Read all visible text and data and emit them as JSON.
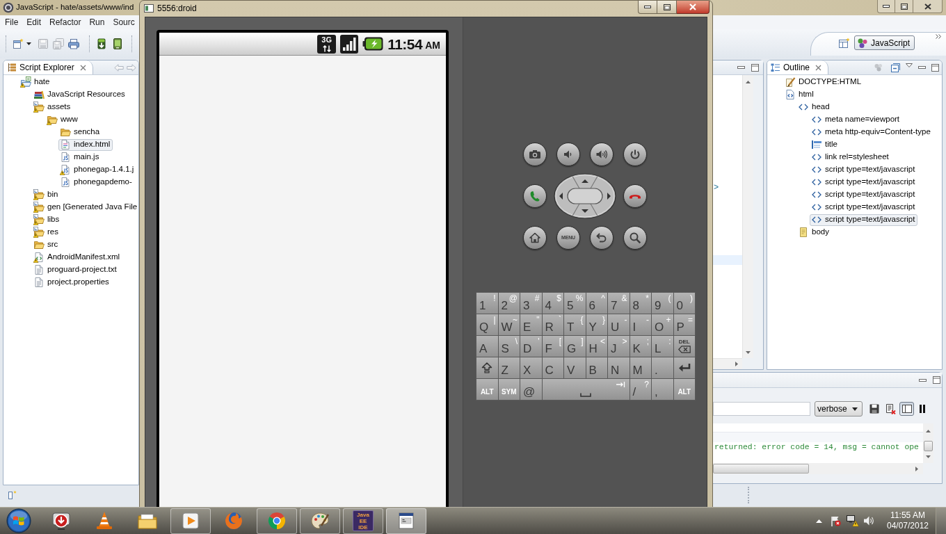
{
  "ide": {
    "title": "JavaScript - hate/assets/www/ind",
    "menu": [
      "File",
      "Edit",
      "Refactor",
      "Run",
      "Sourc"
    ],
    "perspectives": [
      {
        "label": "JavaScript",
        "selected": true
      }
    ],
    "script_explorer": {
      "title": "Script Explorer",
      "tree": [
        {
          "label": "hate",
          "kind": "project",
          "warning": true,
          "selected": false,
          "children": [
            {
              "label": "JavaScript Resources",
              "kind": "library",
              "warning": false,
              "selected": false
            },
            {
              "label": "assets",
              "kind": "source-folder",
              "warning": true,
              "selected": false,
              "children": [
                {
                  "label": "www",
                  "kind": "folder",
                  "warning": true,
                  "selected": false,
                  "children": [
                    {
                      "label": "sencha",
                      "kind": "folder",
                      "warning": false,
                      "selected": false
                    },
                    {
                      "label": "index.html",
                      "kind": "html",
                      "warning": false,
                      "selected": true
                    },
                    {
                      "label": "main.js",
                      "kind": "js",
                      "warning": false,
                      "selected": false
                    },
                    {
                      "label": "phonegap-1.4.1.j",
                      "kind": "js",
                      "warning": true,
                      "selected": false
                    },
                    {
                      "label": "phonegapdemo-",
                      "kind": "js",
                      "warning": false,
                      "selected": false
                    }
                  ]
                }
              ]
            },
            {
              "label": "bin",
              "kind": "source-folder",
              "warning": true,
              "selected": false
            },
            {
              "label": "gen [Generated Java File",
              "kind": "source-folder",
              "warning": true,
              "selected": false
            },
            {
              "label": "libs",
              "kind": "source-folder",
              "warning": true,
              "selected": false
            },
            {
              "label": "res",
              "kind": "source-folder",
              "warning": true,
              "selected": false
            },
            {
              "label": "src",
              "kind": "folder",
              "warning": false,
              "selected": false
            },
            {
              "label": "AndroidManifest.xml",
              "kind": "xml",
              "warning": true,
              "selected": false
            },
            {
              "label": "proguard-project.txt",
              "kind": "text",
              "warning": false,
              "selected": false
            },
            {
              "label": "project.properties",
              "kind": "text",
              "warning": false,
              "selected": false
            }
          ]
        }
      ]
    },
    "editor": {
      "visible_text": ">"
    },
    "outline": {
      "title": "Outline",
      "tree": [
        {
          "label": "DOCTYPE:HTML",
          "kind": "doctype",
          "selected": false
        },
        {
          "label": "html",
          "kind": "document",
          "selected": false,
          "children": [
            {
              "label": "head",
              "kind": "tag",
              "selected": false,
              "children": [
                {
                  "label": "meta name=viewport",
                  "kind": "tag",
                  "selected": false
                },
                {
                  "label": "meta http-equiv=Content-type",
                  "kind": "tag",
                  "selected": false
                },
                {
                  "label": "title",
                  "kind": "title",
                  "selected": false
                },
                {
                  "label": "link rel=stylesheet",
                  "kind": "tag",
                  "selected": false
                },
                {
                  "label": "script type=text/javascript",
                  "kind": "tag",
                  "selected": false
                },
                {
                  "label": "script type=text/javascript",
                  "kind": "tag",
                  "selected": false
                },
                {
                  "label": "script type=text/javascript",
                  "kind": "tag",
                  "selected": false
                },
                {
                  "label": "script type=text/javascript",
                  "kind": "tag",
                  "selected": false
                },
                {
                  "label": "script type=text/javascript",
                  "kind": "tag",
                  "selected": true
                }
              ]
            },
            {
              "label": "body",
              "kind": "body",
              "selected": false
            }
          ]
        }
      ]
    },
    "logcat": {
      "log_level": "verbose",
      "filter_pane_on": true,
      "messages": [
        "returned: error code = 14, msg = cannot ope"
      ]
    }
  },
  "emulator": {
    "title": "5556:droid",
    "status_bar": {
      "network": "3G",
      "time": "11:54",
      "meridiem": "AM"
    },
    "buttons": [
      {
        "kind": "camera"
      },
      {
        "kind": "volume-down"
      },
      {
        "kind": "volume-up"
      },
      {
        "kind": "power"
      },
      {
        "kind": "call"
      },
      {
        "kind": "dpad"
      },
      {
        "kind": "end-call"
      },
      {
        "kind": "home"
      },
      {
        "kind": "menu",
        "label": "MENU"
      },
      {
        "kind": "back"
      },
      {
        "kind": "search"
      }
    ],
    "keyboard": [
      [
        {
          "kind": "char",
          "key": "1",
          "alt": "!"
        },
        {
          "kind": "char",
          "key": "2",
          "alt": "@"
        },
        {
          "kind": "char",
          "key": "3",
          "alt": "#"
        },
        {
          "kind": "char",
          "key": "4",
          "alt": "$"
        },
        {
          "kind": "char",
          "key": "5",
          "alt": "%"
        },
        {
          "kind": "char",
          "key": "6",
          "alt": "^"
        },
        {
          "kind": "char",
          "key": "7",
          "alt": "&"
        },
        {
          "kind": "char",
          "key": "8",
          "alt": "*"
        },
        {
          "kind": "char",
          "key": "9",
          "alt": "("
        },
        {
          "kind": "char",
          "key": "0",
          "alt": ")"
        }
      ],
      [
        {
          "kind": "char",
          "key": "Q",
          "alt": "|"
        },
        {
          "kind": "char",
          "key": "W",
          "alt": "~"
        },
        {
          "kind": "char",
          "key": "E",
          "alt": "\""
        },
        {
          "kind": "char",
          "key": "R",
          "alt": "`"
        },
        {
          "kind": "char",
          "key": "T",
          "alt": "{"
        },
        {
          "kind": "char",
          "key": "Y",
          "alt": "}"
        },
        {
          "kind": "char",
          "key": "U",
          "alt": "-"
        },
        {
          "kind": "char",
          "key": "I",
          "alt": "-"
        },
        {
          "kind": "char",
          "key": "O",
          "alt": "+"
        },
        {
          "kind": "char",
          "key": "P",
          "alt": "="
        }
      ],
      [
        {
          "kind": "char",
          "key": "A"
        },
        {
          "kind": "char",
          "key": "S",
          "alt": "\\"
        },
        {
          "kind": "char",
          "key": "D",
          "alt": "'"
        },
        {
          "kind": "char",
          "key": "F",
          "alt": "["
        },
        {
          "kind": "char",
          "key": "G",
          "alt": "]"
        },
        {
          "kind": "char",
          "key": "H",
          "alt": "<"
        },
        {
          "kind": "char",
          "key": "J",
          "alt": ">"
        },
        {
          "kind": "char",
          "key": "K",
          "alt": ";"
        },
        {
          "kind": "char",
          "key": "L",
          "alt": ":"
        },
        {
          "kind": "del",
          "label": "DEL"
        }
      ],
      [
        {
          "kind": "shift"
        },
        {
          "kind": "char",
          "key": "Z"
        },
        {
          "kind": "char",
          "key": "X"
        },
        {
          "kind": "char",
          "key": "C"
        },
        {
          "kind": "char",
          "key": "V"
        },
        {
          "kind": "char",
          "key": "B"
        },
        {
          "kind": "char",
          "key": "N"
        },
        {
          "kind": "char",
          "key": "M"
        },
        {
          "kind": "char",
          "key": "."
        },
        {
          "kind": "enter"
        }
      ],
      [
        {
          "kind": "mod",
          "label": "ALT"
        },
        {
          "kind": "mod",
          "label": "SYM"
        },
        {
          "kind": "char",
          "key": "@"
        },
        {
          "kind": "space"
        },
        {
          "kind": "char",
          "key": "/",
          "alt": "?"
        },
        {
          "kind": "char",
          "key": ","
        },
        {
          "kind": "mod",
          "label": "ALT"
        }
      ]
    ]
  },
  "taskbar": {
    "apps": [
      {
        "kind": "download",
        "running": false,
        "selected": false
      },
      {
        "kind": "cone",
        "running": false,
        "selected": false
      },
      {
        "kind": "folder",
        "running": false,
        "selected": false
      },
      {
        "kind": "player",
        "running": true,
        "selected": false
      },
      {
        "kind": "globe",
        "running": false,
        "selected": false
      },
      {
        "kind": "browser",
        "running": true,
        "selected": false
      },
      {
        "kind": "palette",
        "running": true,
        "selected": false
      },
      {
        "kind": "ide",
        "label": "Java EE IDE",
        "running": true,
        "selected": false
      },
      {
        "kind": "emulator",
        "running": true,
        "selected": true
      }
    ],
    "clock": {
      "time": "11:55 AM",
      "date": "04/07/2012"
    }
  }
}
